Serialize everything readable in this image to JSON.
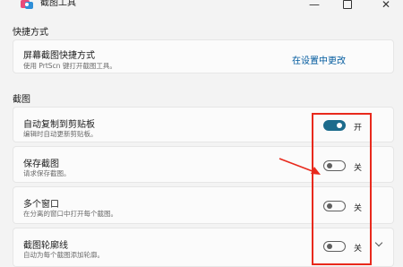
{
  "window": {
    "title": "截图工具",
    "minimize_glyph": "—",
    "close_glyph": "✕"
  },
  "sections": {
    "shortcut_label": "快捷方式",
    "snip_label": "截图"
  },
  "shortcut_card": {
    "title": "屏幕截图快捷方式",
    "description": "使用 PrtScn 键打开截图工具。",
    "link": "在设置中更改"
  },
  "settings": [
    {
      "title": "自动复制到剪贴板",
      "description": "编辑时自动更新剪贴板。",
      "state": "开",
      "on": true
    },
    {
      "title": "保存截图",
      "description": "请求保存截图。",
      "state": "关",
      "on": false
    },
    {
      "title": "多个窗口",
      "description": "在分离的窗口中打开每个截图。",
      "state": "关",
      "on": false
    },
    {
      "title": "截图轮廓线",
      "description": "自动为每个截图添加轮廓。",
      "state": "关",
      "on": false
    }
  ],
  "colors": {
    "toggle_on": "#1c6b8c",
    "link": "#005a9e",
    "annotation": "#e8291c"
  }
}
